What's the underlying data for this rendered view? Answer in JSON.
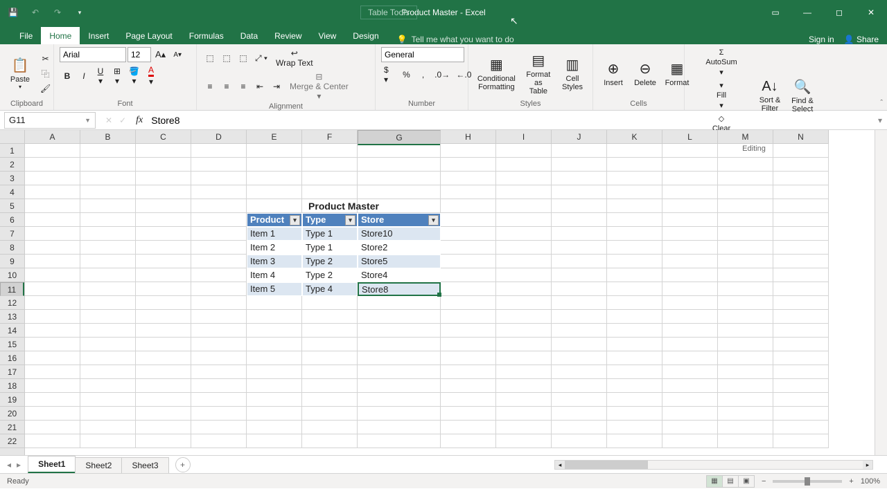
{
  "title": "Product Master - Excel",
  "contextual_tab_group": "Table Tools",
  "tabs": [
    "File",
    "Home",
    "Insert",
    "Page Layout",
    "Formulas",
    "Data",
    "Review",
    "View",
    "Design"
  ],
  "active_tab": "Home",
  "tellme_placeholder": "Tell me what you want to do",
  "signin": "Sign in",
  "share": "Share",
  "ribbon": {
    "clipboard": {
      "paste": "Paste",
      "label": "Clipboard"
    },
    "font": {
      "name": "Arial",
      "size": "12",
      "label": "Font",
      "bold": "B",
      "italic": "I",
      "underline": "U"
    },
    "alignment": {
      "wrap": "Wrap Text",
      "merge": "Merge & Center",
      "label": "Alignment"
    },
    "number": {
      "format": "General",
      "label": "Number"
    },
    "styles": {
      "cond": "Conditional Formatting",
      "fat": "Format as Table",
      "cell": "Cell Styles",
      "label": "Styles"
    },
    "cells": {
      "insert": "Insert",
      "delete": "Delete",
      "format": "Format",
      "label": "Cells"
    },
    "editing": {
      "autosum": "AutoSum",
      "fill": "Fill",
      "clear": "Clear",
      "sort": "Sort & Filter",
      "find": "Find & Select",
      "label": "Editing"
    }
  },
  "namebox": "G11",
  "formula": "Store8",
  "columns": [
    "A",
    "B",
    "C",
    "D",
    "E",
    "F",
    "G",
    "H",
    "I",
    "J",
    "K",
    "L",
    "M",
    "N"
  ],
  "rows_visible": 22,
  "selected_col": "G",
  "selected_row": 11,
  "table": {
    "title": "Product Master",
    "title_cell": "F5",
    "headers": [
      "Product",
      "Type",
      "Store"
    ],
    "header_row": 6,
    "cols": [
      "E",
      "F",
      "G"
    ],
    "data": [
      [
        "Item 1",
        "Type 1",
        "Store10"
      ],
      [
        "Item 2",
        "Type 1",
        "Store2"
      ],
      [
        "Item 3",
        "Type 2",
        "Store5"
      ],
      [
        "Item 4",
        "Type 2",
        "Store4"
      ],
      [
        "Item 5",
        "Type 4",
        "Store8"
      ]
    ]
  },
  "sheets": [
    "Sheet1",
    "Sheet2",
    "Sheet3"
  ],
  "active_sheet": "Sheet1",
  "status": "Ready",
  "zoom": "100%"
}
